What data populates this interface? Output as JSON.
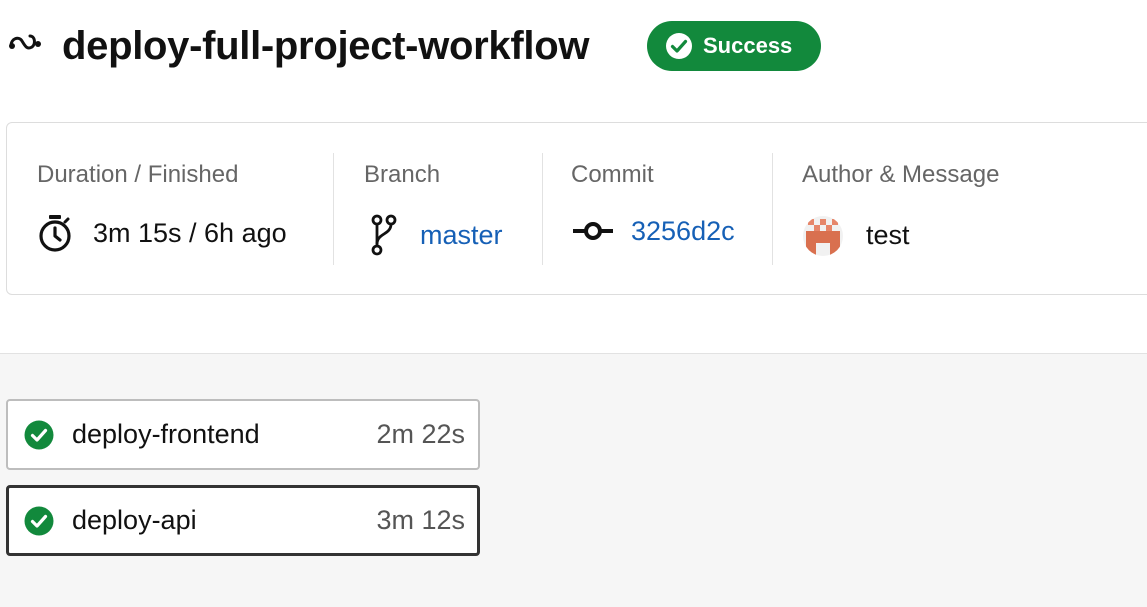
{
  "workflow": {
    "icon": "workflow-icon",
    "title": "deploy-full-project-workflow",
    "status": "Success",
    "status_color": "#12893c"
  },
  "info": {
    "duration": {
      "label": "Duration / Finished",
      "value": "3m 15s / 6h ago",
      "icon": "stopwatch-icon"
    },
    "branch": {
      "label": "Branch",
      "value": "master",
      "icon": "branch-icon"
    },
    "commit": {
      "label": "Commit",
      "value": "3256d2c",
      "icon": "commit-icon"
    },
    "author": {
      "label": "Author & Message",
      "message": "test",
      "icon": "avatar"
    }
  },
  "jobs": [
    {
      "name": "deploy-frontend",
      "duration": "2m 22s",
      "status": "success"
    },
    {
      "name": "deploy-api",
      "duration": "3m 12s",
      "status": "success",
      "selected": true
    }
  ],
  "colors": {
    "link": "#1660b6",
    "success": "#12893c"
  }
}
